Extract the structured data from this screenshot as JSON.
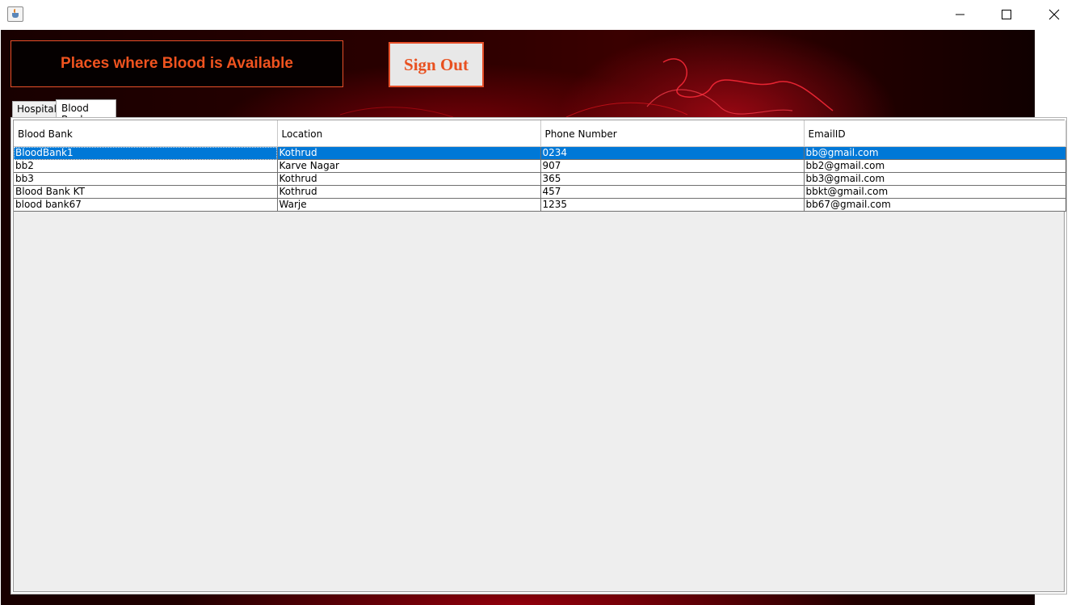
{
  "window": {
    "icon": "java-cup-icon",
    "controls": [
      "minimize-icon",
      "maximize-icon",
      "close-icon"
    ]
  },
  "header": {
    "title": "Places where Blood is Available",
    "signout_label": "Sign Out"
  },
  "tabs": [
    {
      "label": "Hospital",
      "selected": false
    },
    {
      "label": "Blood Bank",
      "selected": true
    }
  ],
  "table": {
    "columns": [
      "Blood Bank",
      "Location",
      "Phone Number",
      "EmailID"
    ],
    "rows": [
      [
        "BloodBank1",
        "Kothrud",
        "0234",
        "bb@gmail.com"
      ],
      [
        "bb2",
        "Karve Nagar",
        "907",
        "bb2@gmail.com"
      ],
      [
        "bb3",
        "Kothrud",
        "365",
        "bb3@gmail.com"
      ],
      [
        "Blood Bank KT",
        "Kothrud",
        "457",
        "bbkt@gmail.com"
      ],
      [
        "blood bank67",
        "Warje",
        "1235",
        "bb67@gmail.com"
      ]
    ],
    "selected_row": 0
  },
  "colors": {
    "accent": "#f0531f",
    "selection": "#0078d7"
  }
}
